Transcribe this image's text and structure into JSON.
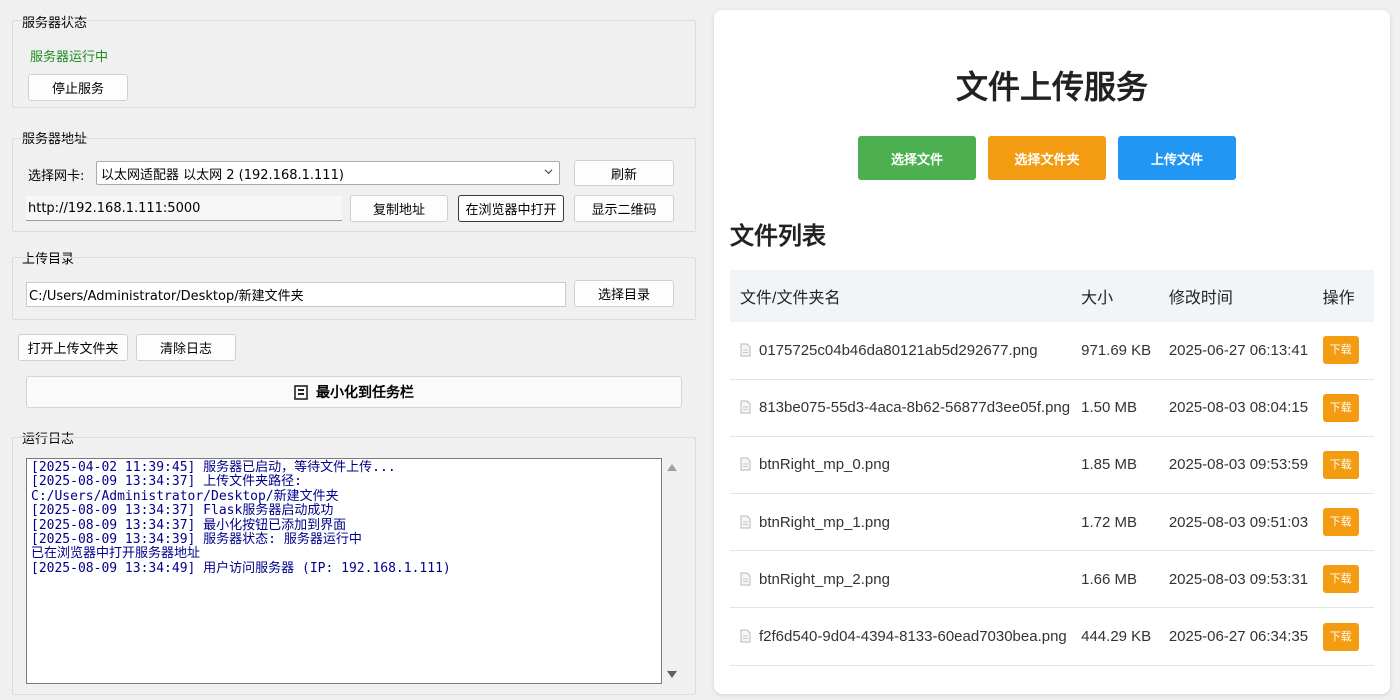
{
  "app": {
    "server_status": {
      "title": "服务器状态",
      "status_text": "服务器运行中",
      "status_color": "#1e8c1e",
      "stop_label": "停止服务"
    },
    "server_address": {
      "title": "服务器地址",
      "nic_label": "选择网卡:",
      "nic_value": "以太网适配器 以太网 2 (192.168.1.111)",
      "refresh_label": "刷新",
      "url": "http://192.168.1.111:5000",
      "copy_label": "复制地址",
      "open_browser_label": "在浏览器中打开",
      "qr_label": "显示二维码"
    },
    "upload_dir": {
      "title": "上传目录",
      "path": "C:/Users/Administrator/Desktop/新建文件夹",
      "choose_label": "选择目录"
    },
    "actions": {
      "open_folder_label": "打开上传文件夹",
      "clear_log_label": "清除日志",
      "minimize_label": "最小化到任务栏"
    },
    "log": {
      "title": "运行日志",
      "lines": [
        "[2025-04-02 11:39:45] 服务器已启动，等待文件上传...",
        "[2025-08-09 13:34:37] 上传文件夹路径:",
        "C:/Users/Administrator/Desktop/新建文件夹",
        "[2025-08-09 13:34:37] Flask服务器启动成功",
        "[2025-08-09 13:34:37] 最小化按钮已添加到界面",
        "[2025-08-09 13:34:39] 服务器状态: 服务器运行中",
        "已在浏览器中打开服务器地址",
        "[2025-08-09 13:34:49] 用户访问服务器 (IP: 192.168.1.111)"
      ],
      "text_color": "#00008b"
    }
  },
  "web": {
    "title": "文件上传服务",
    "buttons": {
      "select_file": "选择文件",
      "select_folder": "选择文件夹",
      "upload": "上传文件"
    },
    "colors": {
      "select_file": "#4caf50",
      "select_folder": "#f39c12",
      "upload": "#2196f3",
      "download": "#f39c12"
    },
    "file_list_title": "文件列表",
    "table": {
      "headers": [
        "文件/文件夹名",
        "大小",
        "修改时间",
        "操作"
      ],
      "rows": [
        {
          "name": "0175725c04b46da80121ab5d292677.png",
          "size": "971.69 KB",
          "mtime": "2025-06-27 06:13:41",
          "action": "下载"
        },
        {
          "name": "813be075-55d3-4aca-8b62-56877d3ee05f.png",
          "size": "1.50 MB",
          "mtime": "2025-08-03 08:04:15",
          "action": "下载"
        },
        {
          "name": "btnRight_mp_0.png",
          "size": "1.85 MB",
          "mtime": "2025-08-03 09:53:59",
          "action": "下载"
        },
        {
          "name": "btnRight_mp_1.png",
          "size": "1.72 MB",
          "mtime": "2025-08-03 09:51:03",
          "action": "下载"
        },
        {
          "name": "btnRight_mp_2.png",
          "size": "1.66 MB",
          "mtime": "2025-08-03 09:53:31",
          "action": "下载"
        },
        {
          "name": "f2f6d540-9d04-4394-8133-60ead7030bea.png",
          "size": "444.29 KB",
          "mtime": "2025-06-27 06:34:35",
          "action": "下载"
        }
      ]
    }
  }
}
